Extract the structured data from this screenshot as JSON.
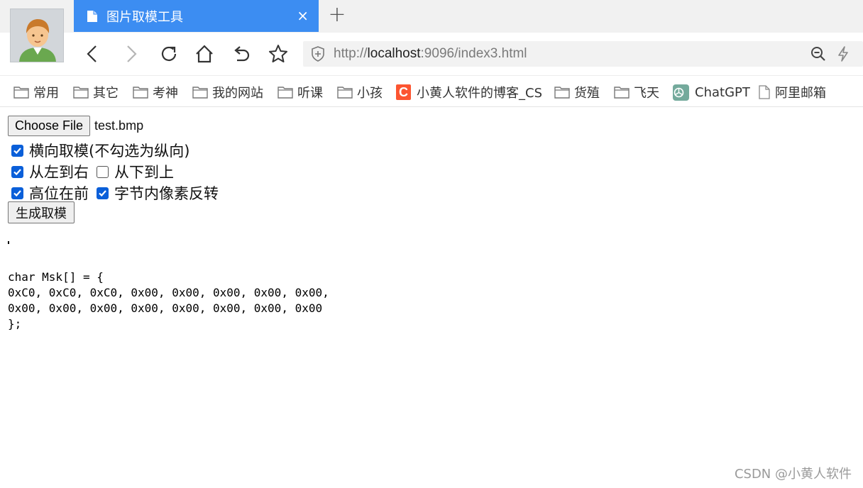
{
  "tab": {
    "title": "图片取模工具",
    "close_glyph": "×"
  },
  "new_tab_glyph": "+",
  "address_bar": {
    "scheme": "http://",
    "host": "localhost",
    "rest": ":9096/index3.html"
  },
  "bookmarks": [
    {
      "label": "常用",
      "icon": "folder-icon"
    },
    {
      "label": "其它",
      "icon": "folder-icon"
    },
    {
      "label": "考神",
      "icon": "folder-icon"
    },
    {
      "label": "我的网站",
      "icon": "folder-icon"
    },
    {
      "label": "听课",
      "icon": "folder-icon"
    },
    {
      "label": "小孩",
      "icon": "folder-icon"
    },
    {
      "label": "小黄人软件的博客_CS",
      "icon": "csdn-logo-icon"
    },
    {
      "label": "货殖",
      "icon": "folder-icon"
    },
    {
      "label": "飞天",
      "icon": "folder-icon"
    },
    {
      "label": "ChatGPT",
      "icon": "chatgpt-logo-icon"
    },
    {
      "label": "阿里邮箱",
      "icon": "page-icon"
    }
  ],
  "form": {
    "choose_file_label": "Choose File",
    "file_name": "test.bmp",
    "horizontal_label": "横向取模(不勾选为纵向)",
    "horizontal_checked": true,
    "left_to_right_label": "从左到右",
    "left_to_right_checked": true,
    "bottom_to_top_label": "从下到上",
    "bottom_to_top_checked": false,
    "msb_first_label": "高位在前",
    "msb_first_checked": true,
    "reverse_label": "字节内像素反转",
    "reverse_checked": true,
    "generate_label": "生成取模"
  },
  "output": {
    "code": "char Msk[] = {\n0xC0, 0xC0, 0xC0, 0x00, 0x00, 0x00, 0x00, 0x00,\n0x00, 0x00, 0x00, 0x00, 0x00, 0x00, 0x00, 0x00\n};"
  },
  "watermark": "CSDN @小黄人软件",
  "colors": {
    "tab_active": "#3c8df2",
    "checkbox_checked": "#0a5fd9",
    "csdn_brand": "#fc5531",
    "chatgpt_brand": "#74aa9c"
  }
}
